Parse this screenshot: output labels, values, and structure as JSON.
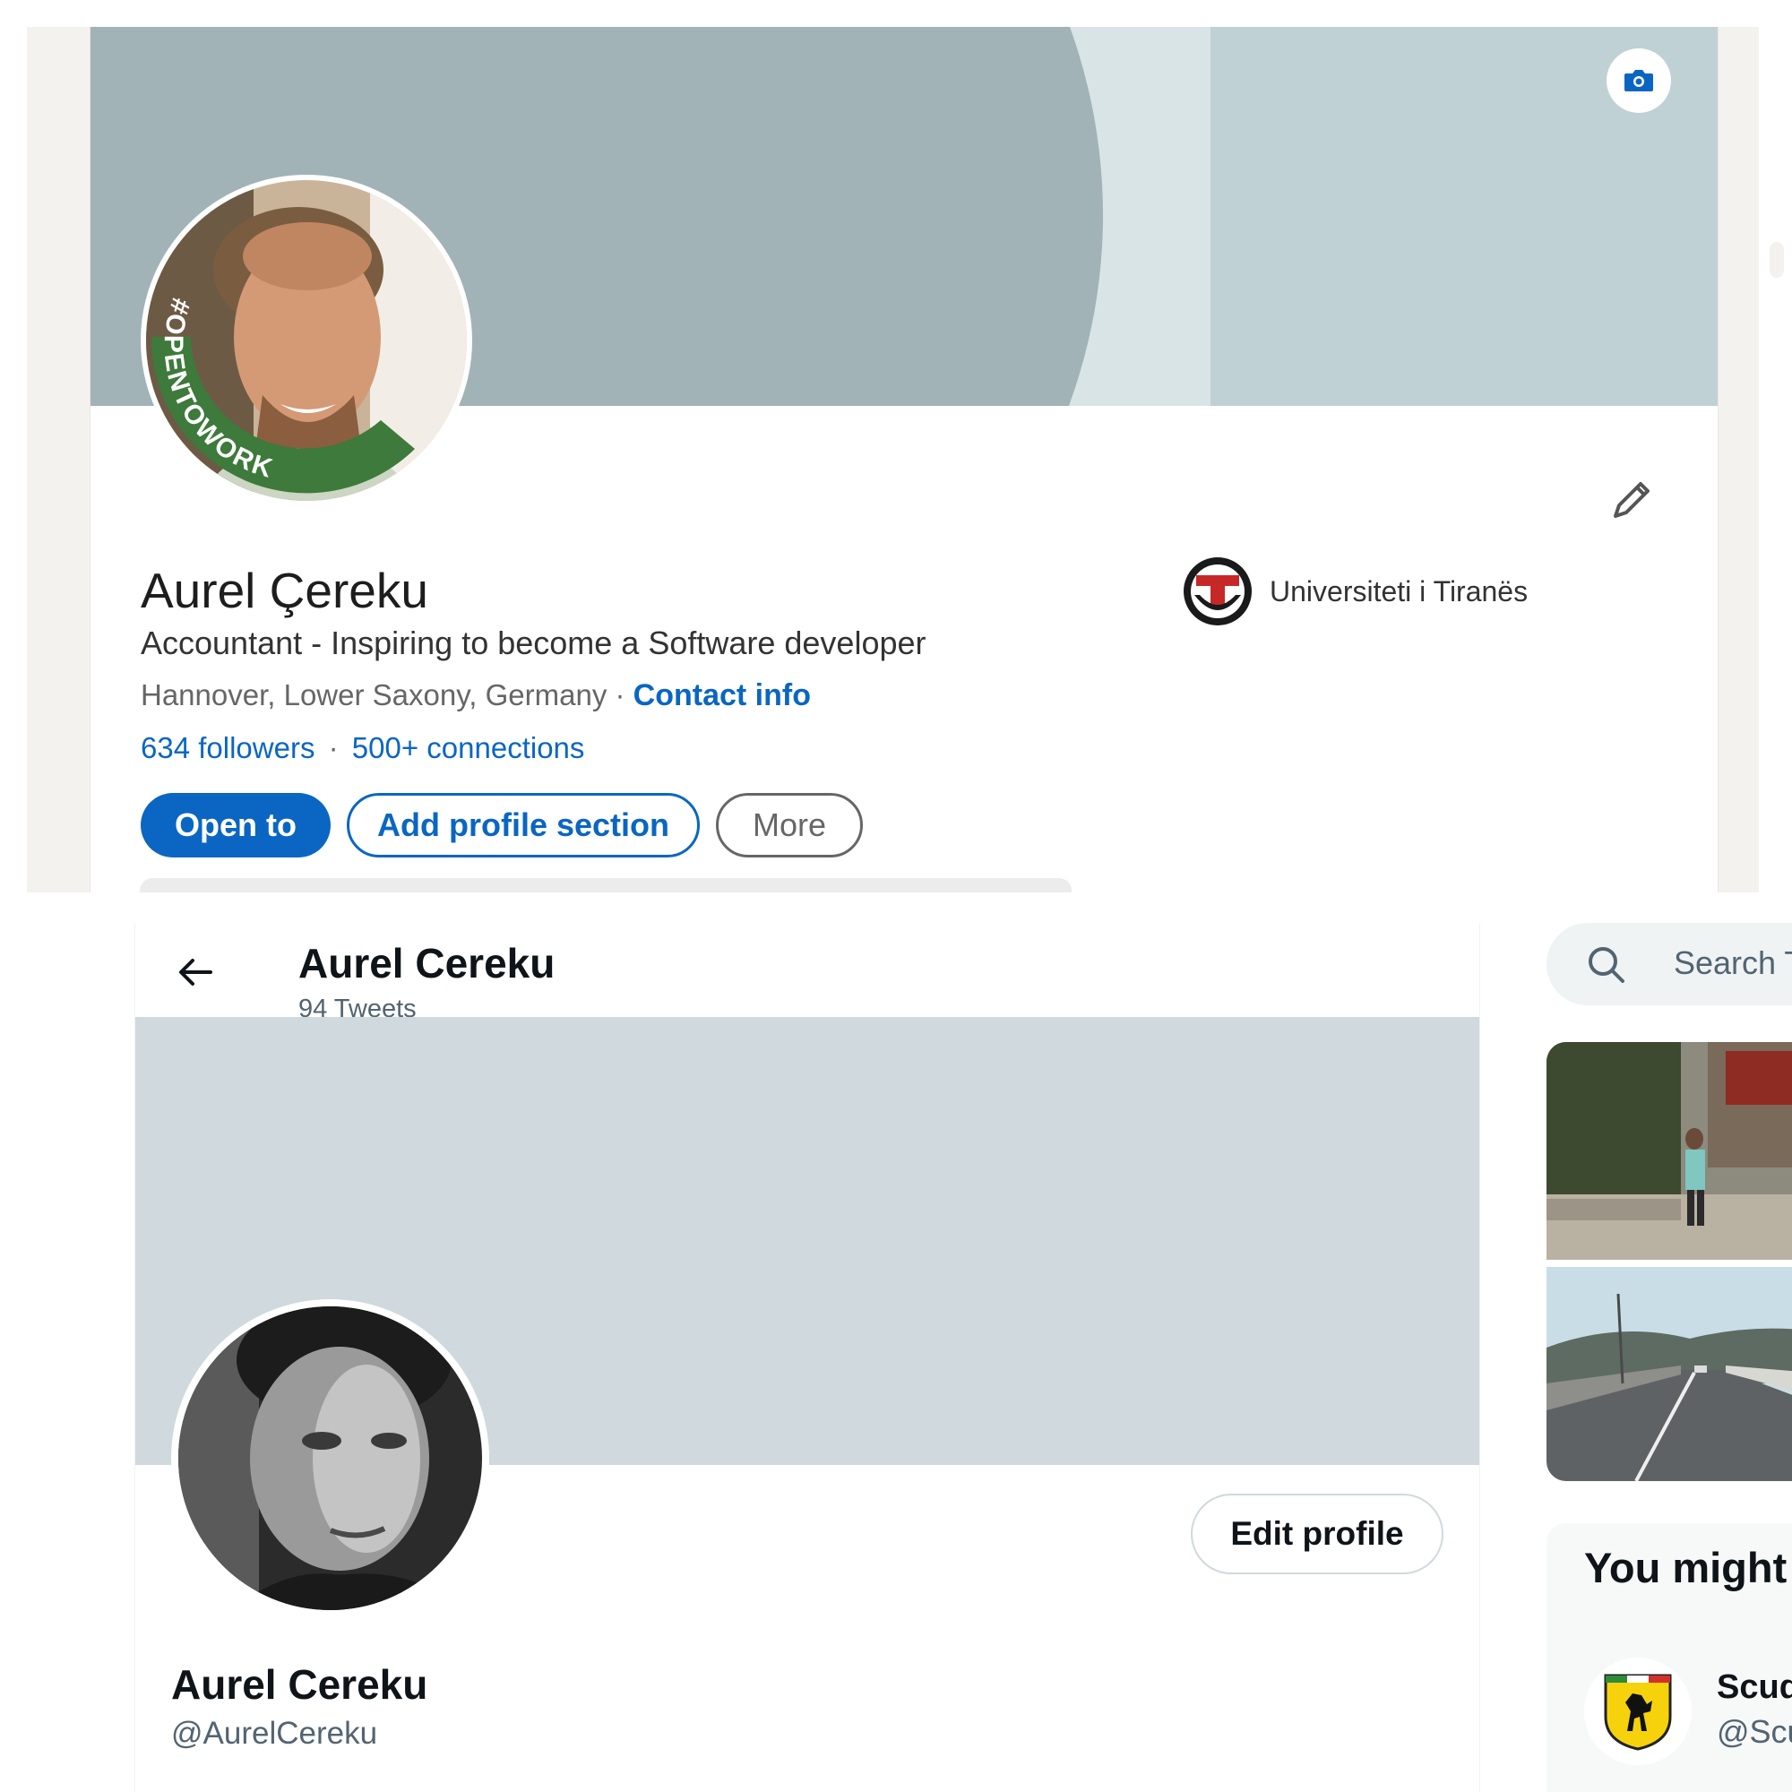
{
  "linkedin": {
    "name": "Aurel Çereku",
    "headline": "Accountant - Inspiring to become a Software developer",
    "location": "Hannover, Lower Saxony, Germany",
    "location_separator": "·",
    "contact_info": "Contact info",
    "followers": "634 followers",
    "stats_separator": "·",
    "connections": "500+ connections",
    "buttons": {
      "open_to": "Open to",
      "add_profile_section": "Add profile section",
      "more": "More"
    },
    "avatar_frame_text": "#OPENTOWORK",
    "school": "Universiteti i Tiranës",
    "accent_color": "#0a66c2",
    "opentowork_color": "#3d7a3b",
    "icons": [
      "camera-icon",
      "pencil-icon",
      "university-logo"
    ]
  },
  "twitter": {
    "header": {
      "name": "Aurel Cereku",
      "tweet_count": "94 Tweets"
    },
    "profile": {
      "name": "Aurel Cereku",
      "handle": "@AurelCereku",
      "edit_profile": "Edit profile"
    },
    "sidebar": {
      "search_placeholder": "Search T",
      "suggestions_title": "You might",
      "suggestion": {
        "name": "Scud",
        "handle": "@Scu"
      }
    },
    "icons": [
      "back-arrow-icon",
      "search-icon",
      "ferrari-logo"
    ]
  }
}
